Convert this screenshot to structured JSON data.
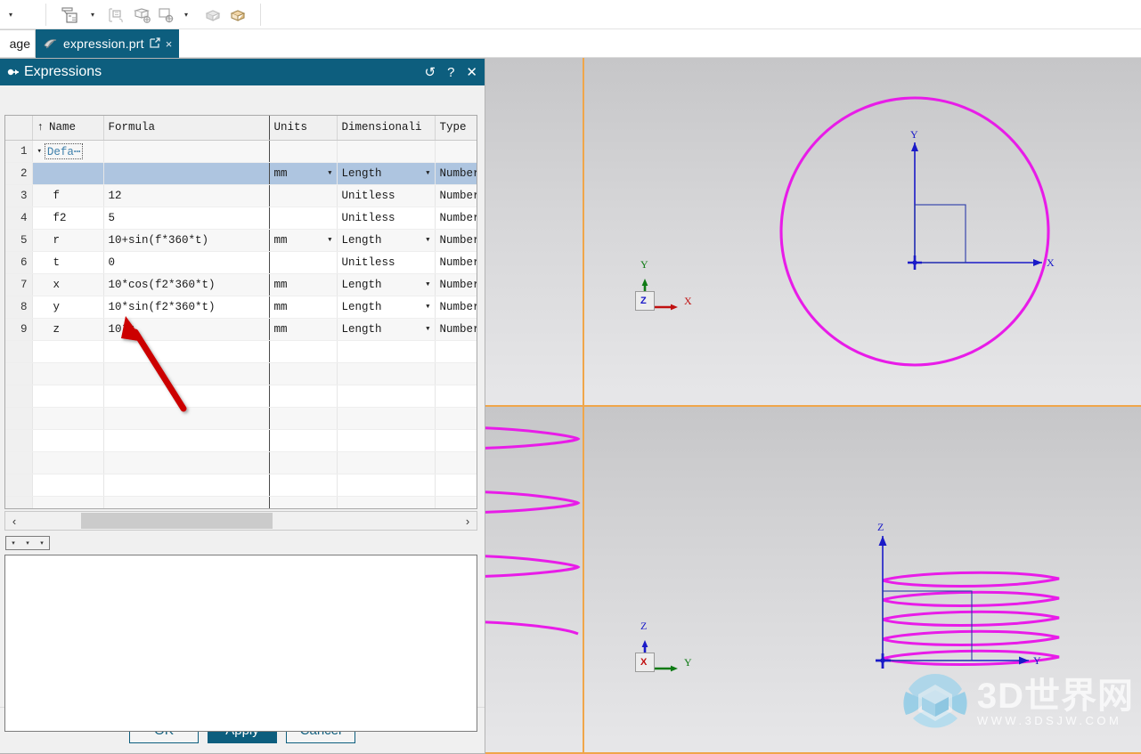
{
  "toolbar": {
    "icons": [
      {
        "name": "dropdown-caret-left",
        "glyph": "▾"
      },
      {
        "name": "measure-icon",
        "glyph": "measure"
      },
      {
        "name": "measure-caret",
        "glyph": "▾"
      },
      {
        "name": "assembly-constraint-icon",
        "glyph": "constraint"
      },
      {
        "name": "move-object-icon",
        "glyph": "move"
      },
      {
        "name": "datum-csys-icon",
        "glyph": "csys"
      },
      {
        "name": "datum-caret",
        "glyph": "▾"
      },
      {
        "name": "shell-body-icon",
        "glyph": "shell"
      },
      {
        "name": "unite-body-icon",
        "glyph": "unite"
      }
    ]
  },
  "tabbar": {
    "inactive_tab_label": "age",
    "active_tab_label": "expression.prt",
    "detach_glyph": "↗",
    "close_glyph": "×"
  },
  "dialog": {
    "title": "Expressions",
    "titlebar_buttons": [
      {
        "name": "reset-button",
        "glyph": "↺"
      },
      {
        "name": "help-button",
        "glyph": "?"
      },
      {
        "name": "close-button",
        "glyph": "✕"
      }
    ],
    "grid": {
      "headers": [
        "",
        "Name",
        "Formula",
        "Units",
        "Dimensionali",
        "Type"
      ],
      "sort_indicator": "↑",
      "rows": [
        {
          "num": "1",
          "name": "Defa⋯",
          "formula": "",
          "units": "",
          "units_dd": false,
          "dim": "",
          "dim_dd": false,
          "type": "",
          "group": true,
          "selected": false
        },
        {
          "num": "2",
          "name": "",
          "formula": "",
          "units": "mm",
          "units_dd": true,
          "dim": "Length",
          "dim_dd": true,
          "type": "Number",
          "group": false,
          "selected": true
        },
        {
          "num": "3",
          "name": "f",
          "formula": "12",
          "units": "",
          "units_dd": false,
          "dim": "Unitless",
          "dim_dd": false,
          "type": "Number",
          "group": false,
          "selected": false
        },
        {
          "num": "4",
          "name": "f2",
          "formula": "5",
          "units": "",
          "units_dd": false,
          "dim": "Unitless",
          "dim_dd": false,
          "type": "Number",
          "group": false,
          "selected": false
        },
        {
          "num": "5",
          "name": "r",
          "formula": "10+sin(f*360*t)",
          "units": "mm",
          "units_dd": true,
          "dim": "Length",
          "dim_dd": true,
          "type": "Number",
          "group": false,
          "selected": false
        },
        {
          "num": "6",
          "name": "t",
          "formula": "0",
          "units": "",
          "units_dd": false,
          "dim": "Unitless",
          "dim_dd": false,
          "type": "Number",
          "group": false,
          "selected": false
        },
        {
          "num": "7",
          "name": "x",
          "formula": "10*cos(f2*360*t)",
          "units": "mm",
          "units_dd": false,
          "dim": "Length",
          "dim_dd": true,
          "type": "Number",
          "group": false,
          "selected": false
        },
        {
          "num": "8",
          "name": "y",
          "formula": "10*sin(f2*360*t)",
          "units": "mm",
          "units_dd": false,
          "dim": "Length",
          "dim_dd": true,
          "type": "Number",
          "group": false,
          "selected": false
        },
        {
          "num": "9",
          "name": "z",
          "formula": "10*t",
          "units": "mm",
          "units_dd": false,
          "dim": "Length",
          "dim_dd": true,
          "type": "Number",
          "group": false,
          "selected": false
        }
      ],
      "empty_rows": 8
    },
    "hscroll": {
      "left_arrow": "‹",
      "right_arrow": "›"
    },
    "minibar": [
      "▾",
      "▾",
      "▾"
    ],
    "formula_editor_value": "",
    "buttons": {
      "ok": "OK",
      "apply": "Apply",
      "cancel": "Cancel"
    }
  },
  "graphics": {
    "views": [
      {
        "name": "top-view",
        "axes": [
          {
            "label": "Y"
          },
          {
            "label": "X"
          }
        ],
        "triad": [
          {
            "label": "Y",
            "color": "#0e7a14"
          },
          {
            "label": "X",
            "color": "#c01010"
          }
        ],
        "triad_glyph": "Z"
      },
      {
        "name": "front-view",
        "axes": [
          {
            "label": "Z"
          },
          {
            "label": "Y"
          }
        ],
        "triad": [
          {
            "label": "Z",
            "color": "#1a1ac8"
          },
          {
            "label": "Y",
            "color": "#0e7a14"
          }
        ],
        "triad_glyph": "X"
      }
    ],
    "curve_color": "#e81ce8",
    "axis_color": "#1a1ac8",
    "split_color": "#f0a64a",
    "helix_turns": 5
  },
  "watermark": {
    "main": "3D世界网",
    "sub": "WWW.3DSJW.COM"
  },
  "annotation": {
    "arrow_color": "#cc0000",
    "points_at": "z-formula-cell"
  }
}
